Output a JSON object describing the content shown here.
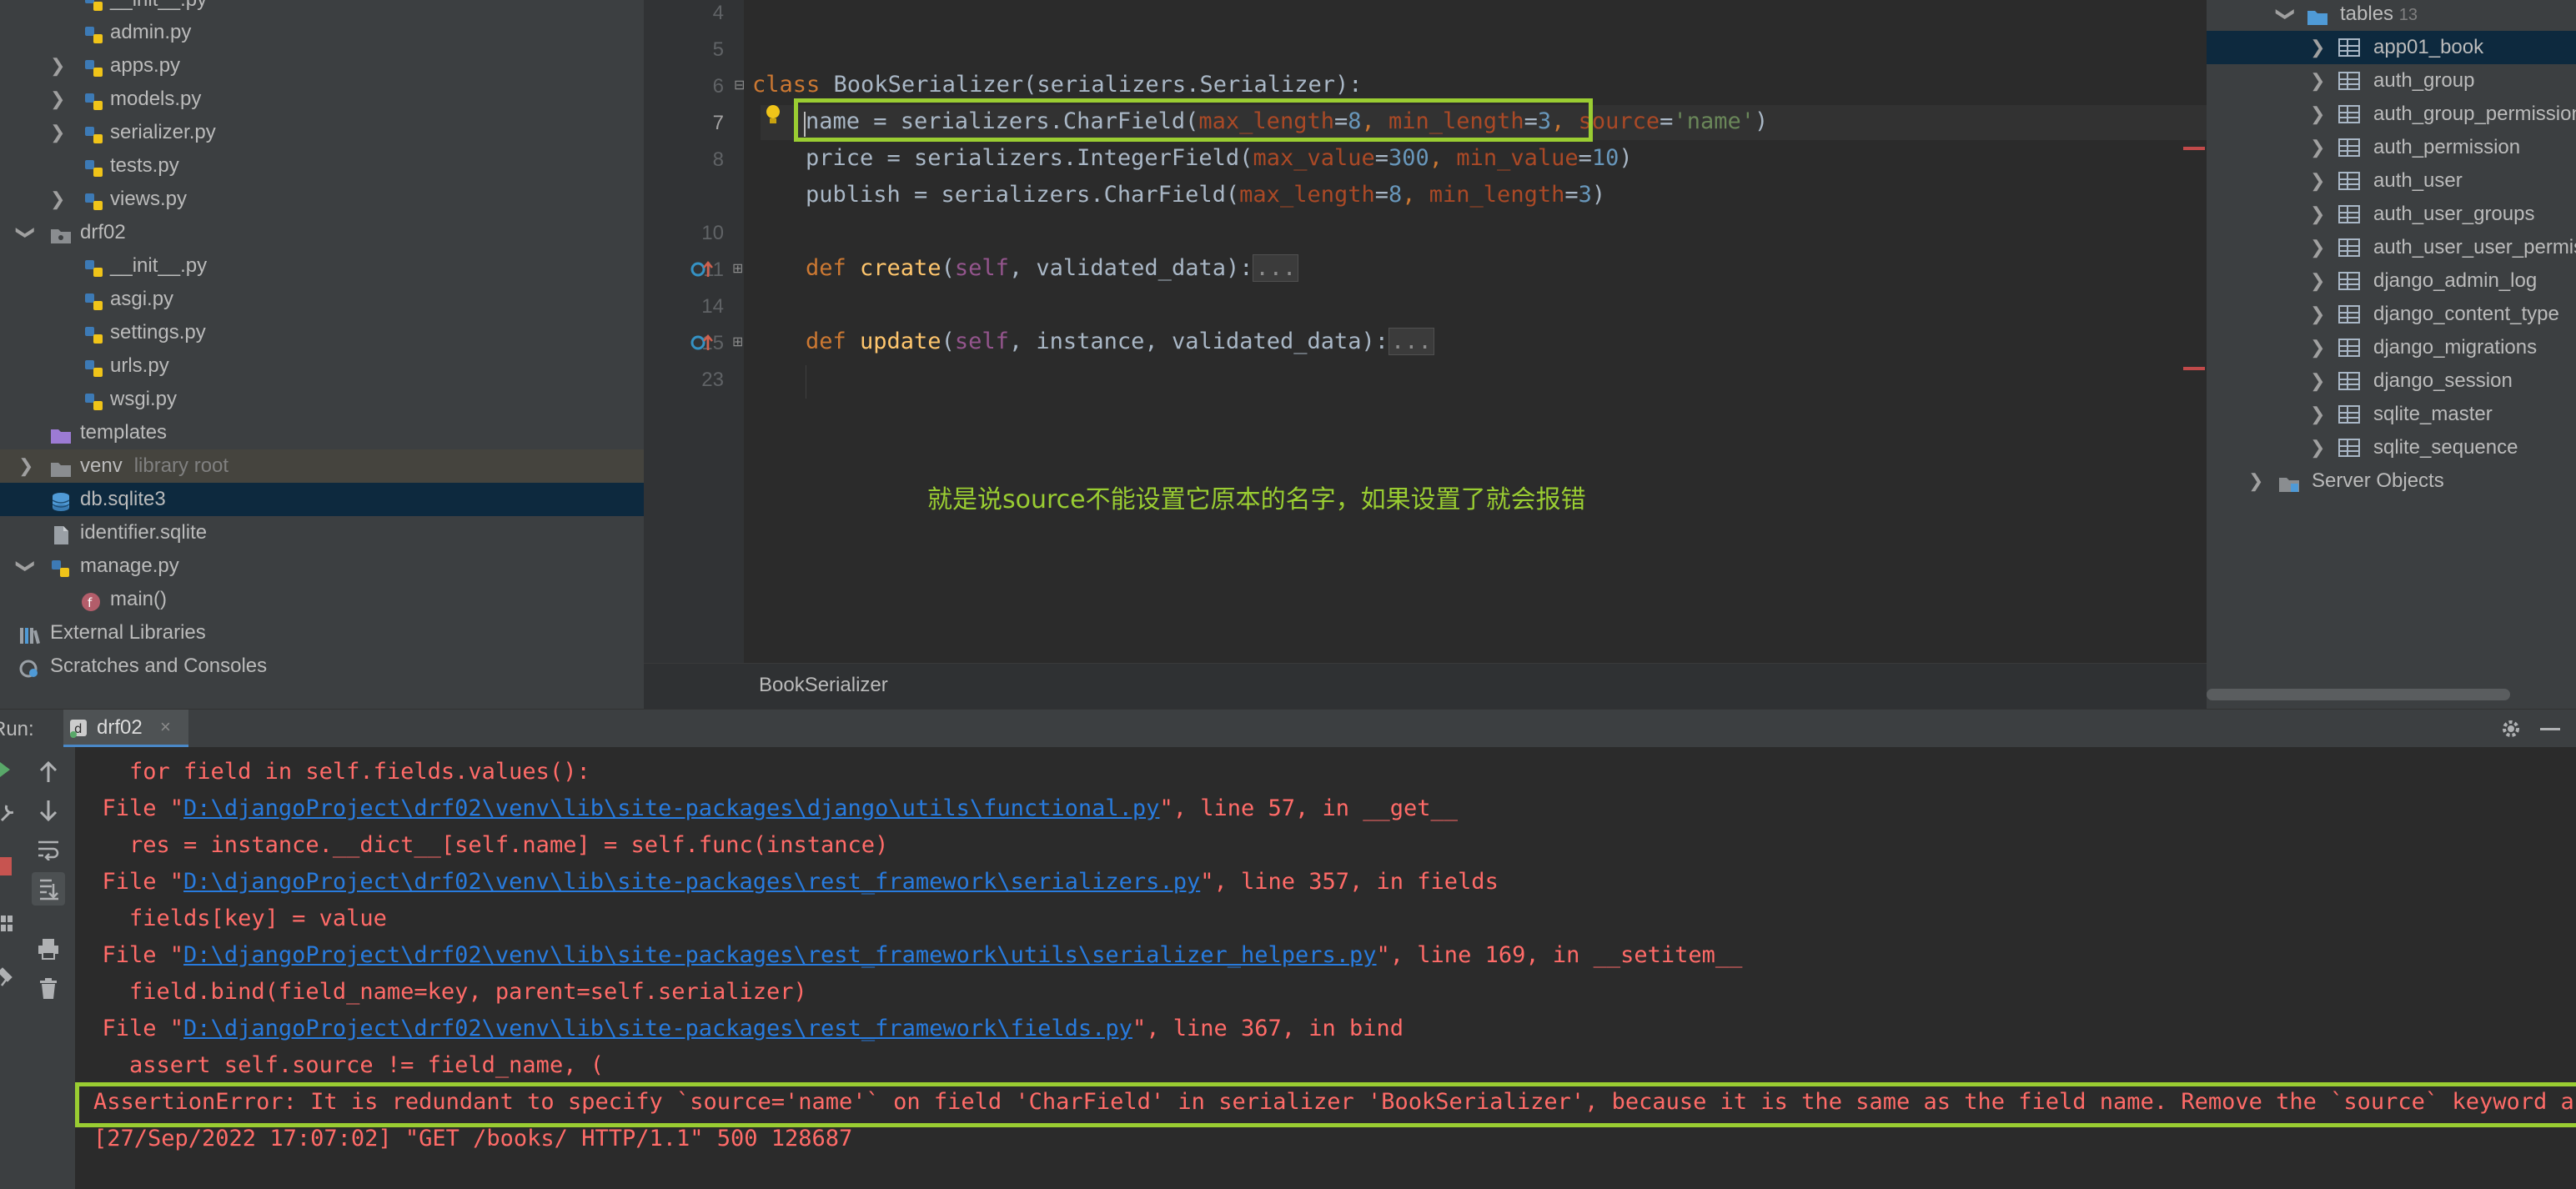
{
  "project_tree": {
    "items": [
      {
        "label": "__init__.py",
        "kind": "py"
      },
      {
        "label": "admin.py",
        "kind": "py"
      },
      {
        "label": "apps.py",
        "kind": "py"
      },
      {
        "label": "models.py",
        "kind": "py"
      },
      {
        "label": "serializer.py",
        "kind": "py"
      },
      {
        "label": "tests.py",
        "kind": "py"
      },
      {
        "label": "views.py",
        "kind": "py"
      },
      {
        "label": "drf02",
        "kind": "folder"
      },
      {
        "label": "__init__.py",
        "kind": "py"
      },
      {
        "label": "asgi.py",
        "kind": "py"
      },
      {
        "label": "settings.py",
        "kind": "py"
      },
      {
        "label": "urls.py",
        "kind": "py"
      },
      {
        "label": "wsgi.py",
        "kind": "py"
      },
      {
        "label": "templates",
        "kind": "folder"
      },
      {
        "label": "venv",
        "hint": "library root",
        "kind": "folder"
      },
      {
        "label": "db.sqlite3",
        "kind": "db"
      },
      {
        "label": "identifier.sqlite",
        "kind": "file"
      },
      {
        "label": "manage.py",
        "kind": "py"
      },
      {
        "label": "main()",
        "kind": "func"
      },
      {
        "label": "External Libraries",
        "kind": "lib"
      },
      {
        "label": "Scratches and Consoles",
        "kind": "scratch"
      }
    ]
  },
  "editor": {
    "line_numbers": [
      "4",
      "5",
      "6",
      "7",
      "8",
      "10",
      "11",
      "14",
      "15",
      "23"
    ],
    "lines": {
      "l6": {
        "kw": "class ",
        "name": "BookSerializer",
        "rest": "(serializers.Serializer):"
      },
      "l7": {
        "a": "name = serializers.CharField(",
        "p1": "max_length",
        "eq1": "=",
        "v1": "8",
        "c1": ", ",
        "p2": "min_length",
        "eq2": "=",
        "v2": "3",
        "c2": ", ",
        "p3": "source",
        "eq3": "=",
        "v3": "'name'",
        "end": ")"
      },
      "l8": {
        "a": "price = serializers.IntegerField(",
        "p1": "max_value",
        "eq1": "=",
        "v1": "300",
        "c1": ", ",
        "p2": "min_value",
        "eq2": "=",
        "v2": "10",
        "end": ")"
      },
      "l10": {
        "a": "publish = serializers.CharField(",
        "p1": "max_length",
        "eq1": "=",
        "v1": "8",
        "c1": ", ",
        "p2": "min_length",
        "eq2": "=",
        "v2": "3",
        "end": ")"
      },
      "l11": {
        "kw": "def ",
        "fn": "create",
        "open": "(",
        "self": "self",
        "rest": ", validated_data):",
        "fold": "..."
      },
      "l15": {
        "kw": "def ",
        "fn": "update",
        "open": "(",
        "self": "self",
        "rest": ", instance, validated_data):",
        "fold": "..."
      }
    },
    "annotation": "就是说source不能设置它原本的名字，如果设置了就会报错",
    "breadcrumb": "BookSerializer"
  },
  "database": {
    "tables_label": "tables",
    "tables_count": "13",
    "tables": [
      "app01_book",
      "auth_group",
      "auth_group_permissions",
      "auth_permission",
      "auth_user",
      "auth_user_groups",
      "auth_user_user_permissions",
      "django_admin_log",
      "django_content_type",
      "django_migrations",
      "django_session",
      "sqlite_master",
      "sqlite_sequence"
    ],
    "server_objects": "Server Objects"
  },
  "run": {
    "label": "Run:",
    "tab": "drf02",
    "lines": [
      {
        "pre": "    for field in self.fields.values():"
      },
      {
        "pre": "  File \"",
        "link": "D:\\djangoProject\\drf02\\venv\\lib\\site-packages\\django\\utils\\functional.py",
        "post": "\", line 57, in __get__"
      },
      {
        "pre": "    res = instance.__dict__[self.name] = self.func(instance)"
      },
      {
        "pre": "  File \"",
        "link": "D:\\djangoProject\\drf02\\venv\\lib\\site-packages\\rest_framework\\serializers.py",
        "post": "\", line 357, in fields"
      },
      {
        "pre": "    fields[key] = value"
      },
      {
        "pre": "  File \"",
        "link": "D:\\djangoProject\\drf02\\venv\\lib\\site-packages\\rest_framework\\utils\\serializer_helpers.py",
        "post": "\", line 169, in __setitem__"
      },
      {
        "pre": "    field.bind(field_name=key, parent=self.serializer)"
      },
      {
        "pre": "  File \"",
        "link": "D:\\djangoProject\\drf02\\venv\\lib\\site-packages\\rest_framework\\fields.py",
        "post": "\", line 367, in bind"
      },
      {
        "pre": "    assert self.source != field_name, ("
      },
      {
        "pre": "AssertionError: It is redundant to specify `source='name'` on field 'CharField' in serializer 'BookSerializer', because it is the same as the field name. Remove the `source` keyword argument."
      },
      {
        "pre": "[27/Sep/2022 17:07:02] \"GET /books/ HTTP/1.1\" 500 128687"
      }
    ]
  }
}
